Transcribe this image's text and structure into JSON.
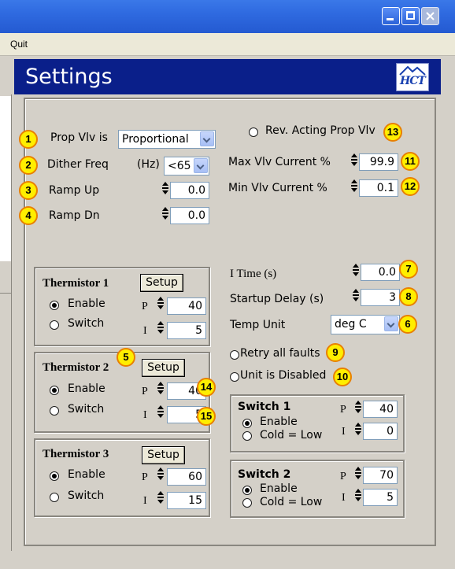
{
  "menubar": {
    "quit": "Quit"
  },
  "header": {
    "title": "Settings",
    "logo_text": "HCT"
  },
  "top": {
    "prop_vlv_label": "Prop Vlv is",
    "prop_vlv_value": "Proportional",
    "dither_label": "Dither Freq",
    "dither_unit": "(Hz)",
    "dither_value": "<65",
    "ramp_up_label": "Ramp Up",
    "ramp_up_value": "0.0",
    "ramp_dn_label": "Ramp Dn",
    "ramp_dn_value": "0.0",
    "rev_acting_label": "Rev. Acting Prop Vlv",
    "max_vlv_label": "Max  Vlv Current %",
    "max_vlv_value": "99.9",
    "min_vlv_label": "Min Vlv   Current %",
    "min_vlv_value": "0.1"
  },
  "right": {
    "itime_label": "I Time (s)",
    "itime_value": "0.0",
    "startup_label": "Startup Delay (s)",
    "startup_value": "3",
    "temp_unit_label": "Temp Unit",
    "temp_unit_value": "deg C",
    "retry_label": "Retry all faults",
    "disabled_label": "Unit is Disabled"
  },
  "thermistors": [
    {
      "title": "Thermistor 1",
      "setup": "Setup",
      "enable": "Enable",
      "switch": "Switch",
      "p": "P",
      "i": "I",
      "p_value": "40",
      "i_value": "5"
    },
    {
      "title": "Thermistor 2",
      "setup": "Setup",
      "enable": "Enable",
      "switch": "Switch",
      "p": "P",
      "i": "I",
      "p_value": "40",
      "i_value": "5"
    },
    {
      "title": "Thermistor 3",
      "setup": "Setup",
      "enable": "Enable",
      "switch": "Switch",
      "p": "P",
      "i": "I",
      "p_value": "60",
      "i_value": "15"
    }
  ],
  "switches": [
    {
      "title": "Switch 1",
      "enable": "Enable",
      "cold": "Cold = Low",
      "p": "P",
      "i": "I",
      "p_value": "40",
      "i_value": "0"
    },
    {
      "title": "Switch 2",
      "enable": "Enable",
      "cold": "Cold = Low",
      "p": "P",
      "i": "I",
      "p_value": "70",
      "i_value": "5"
    }
  ],
  "badges": [
    "1",
    "2",
    "3",
    "4",
    "5",
    "6",
    "7",
    "8",
    "9",
    "10",
    "11",
    "12",
    "13",
    "14",
    "15"
  ],
  "colors": {
    "header_bg": "#0a1f8a",
    "badge_fill": "#ffee00",
    "badge_border": "#e88000",
    "titlebar": "#2f6ae0"
  }
}
